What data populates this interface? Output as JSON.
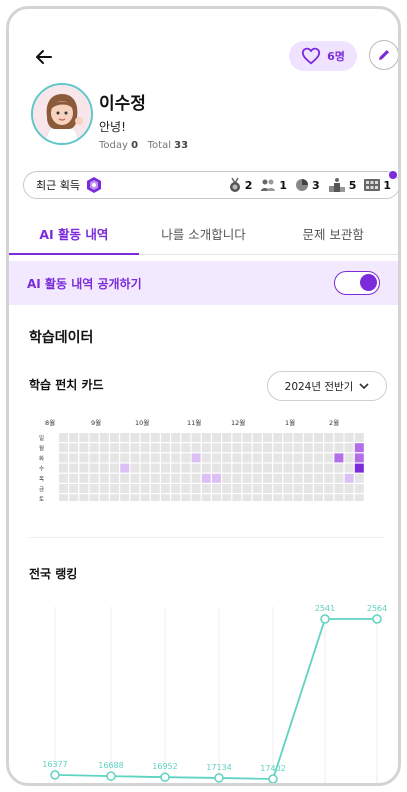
{
  "profile": {
    "name": "이수정",
    "bio": "안녕!",
    "today_label": "Today",
    "today_value": "0",
    "total_label": "Total",
    "total_value": "33",
    "likes": "6명"
  },
  "badges": {
    "recent_label": "최근 획득",
    "counts": [
      {
        "icon": "medal-icon",
        "value": "2"
      },
      {
        "icon": "people-icon",
        "value": "1"
      },
      {
        "icon": "chart-icon",
        "value": "3"
      },
      {
        "icon": "podium-icon",
        "value": "5"
      },
      {
        "icon": "grid-icon",
        "value": "1"
      }
    ]
  },
  "tabs": [
    "AI 활동 내역",
    "나를 소개합니다",
    "문제 보관함"
  ],
  "share": {
    "label": "AI 활동 내역 공개하기",
    "enabled": true
  },
  "learning": {
    "section_title": "학습데이터",
    "card_title": "학습 펀치 카드",
    "period": "2024년 전반기"
  },
  "punchcard": {
    "months": [
      "8월",
      "9월",
      "10월",
      "11월",
      "12월",
      "1월",
      "2월"
    ],
    "days": [
      "일",
      "월",
      "화",
      "수",
      "목",
      "금",
      "토"
    ],
    "weeks": 30,
    "active_cells": [
      {
        "week": 13,
        "day": 2,
        "level": 1
      },
      {
        "week": 6,
        "day": 3,
        "level": 1
      },
      {
        "week": 14,
        "day": 4,
        "level": 1
      },
      {
        "week": 15,
        "day": 4,
        "level": 1
      },
      {
        "week": 27,
        "day": 2,
        "level": 2
      },
      {
        "week": 29,
        "day": 1,
        "level": 2
      },
      {
        "week": 29,
        "day": 2,
        "level": 2
      },
      {
        "week": 29,
        "day": 3,
        "level": 3
      },
      {
        "week": 28,
        "day": 4,
        "level": 1
      }
    ],
    "colors": {
      "empty": "#e5e5e5",
      "l1": "#dcc0f5",
      "l2": "#b26de8",
      "l3": "#7b2bd9"
    }
  },
  "ranking": {
    "title": "전국 랭킹",
    "color": "#5fd3c1"
  },
  "chart_data": {
    "type": "line",
    "title": "전국 랭킹",
    "x": [
      1,
      2,
      3,
      4,
      5,
      6,
      7
    ],
    "values": [
      16377,
      16688,
      16952,
      17134,
      17402,
      2541,
      2564
    ],
    "labels": [
      "16377",
      "16688",
      "16952",
      "17134",
      "17402",
      "2541",
      "2564"
    ],
    "y_inverted": true,
    "grid": "vertical"
  }
}
